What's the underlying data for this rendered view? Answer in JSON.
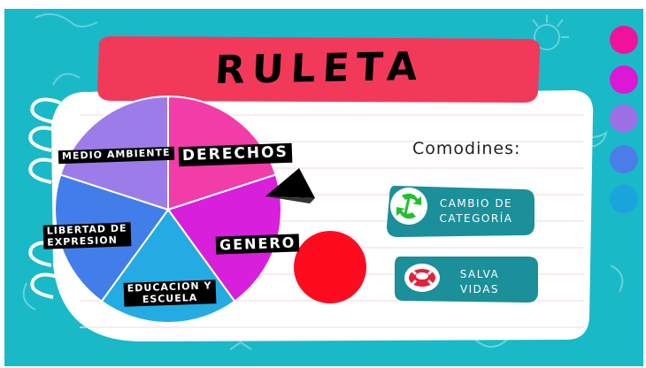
{
  "title": "RULETA",
  "colors": {
    "background": "#19b9c8",
    "title_banner": "#f2395a",
    "notebook": "#ffffff",
    "line": "#f3dfe4",
    "pointer": "#000000",
    "spin_button": "#ff0b1f",
    "pill": "#1b8f9a",
    "sidebar_dots": [
      "#f0129b",
      "#dd17d6",
      "#9d6fe6",
      "#4a7de8",
      "#1aa5de"
    ]
  },
  "wheel": {
    "segments": [
      {
        "label": "DERECHOS",
        "color": "#f23ca8"
      },
      {
        "label": "GENERO",
        "color": "#d81fdc"
      },
      {
        "label": "EDUCACION Y ESCUELA",
        "color": "#24abe3"
      },
      {
        "label": "LIBERTAD DE EXPRESION",
        "color": "#417ee9"
      },
      {
        "label": "MEDIO AMBIENTE",
        "color": "#9c7ce9"
      }
    ],
    "labels": {
      "derechos": "DERECHOS",
      "genero": "GENERO",
      "educacion": "EDUCACION Y\nESCUELA",
      "libertad": "LIBERTAD DE\nEXPRESION",
      "medio": "MEDIO AMBIENTE"
    }
  },
  "comodines_title": "Comodines:",
  "buttons": {
    "cambio": "CAMBIO DE\nCATEGORÍA",
    "salva": "SALVA\nVIDAS"
  },
  "icons": {
    "cambio": "recycle-arrows-icon",
    "salva": "life-ring-icon"
  }
}
